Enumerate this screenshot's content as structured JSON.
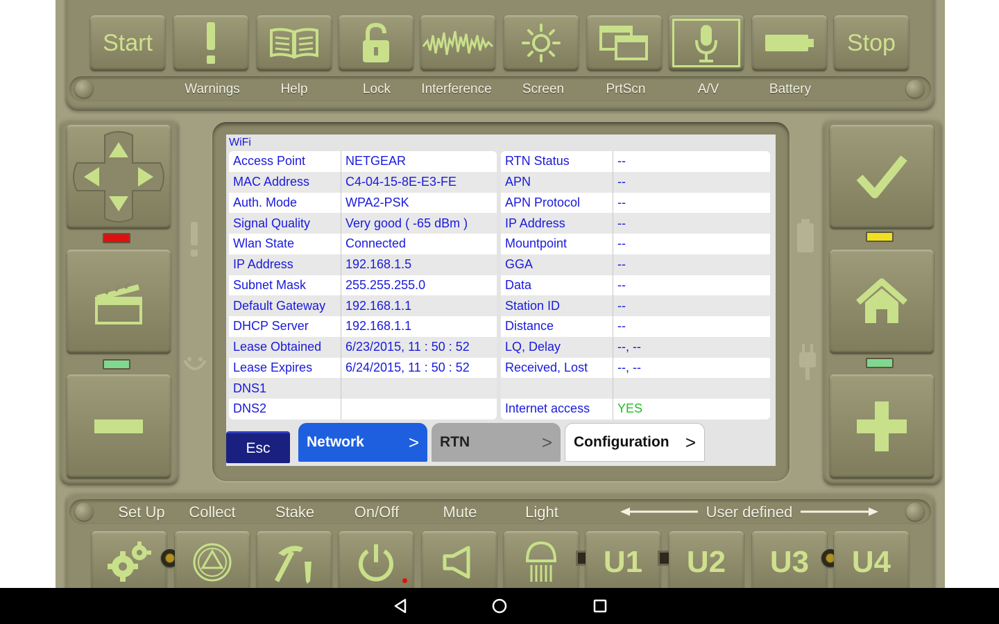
{
  "toolbar": {
    "start_label": "Start",
    "stop_label": "Stop",
    "labels": {
      "warnings": "Warnings",
      "help": "Help",
      "lock": "Lock",
      "interference": "Interference",
      "screen": "Screen",
      "prtscn": "PrtScn",
      "av": "A/V",
      "battery": "Battery"
    }
  },
  "screen": {
    "section_title": "WiFi",
    "wifi_rows": [
      {
        "label": "Access Point",
        "value": "NETGEAR"
      },
      {
        "label": "MAC Address",
        "value": "C4-04-15-8E-E3-FE"
      },
      {
        "label": "Auth. Mode",
        "value": "WPA2-PSK"
      },
      {
        "label": "Signal Quality",
        "value": "Very good ( -65 dBm )"
      },
      {
        "label": "Wlan State",
        "value": "Connected"
      },
      {
        "label": "IP Address",
        "value": "192.168.1.5"
      },
      {
        "label": "Subnet Mask",
        "value": "255.255.255.0"
      },
      {
        "label": "Default Gateway",
        "value": "192.168.1.1"
      },
      {
        "label": "DHCP Server",
        "value": "192.168.1.1"
      },
      {
        "label": "Lease Obtained",
        "value": "6/23/2015, 11 : 50 : 52"
      },
      {
        "label": "Lease Expires",
        "value": "6/24/2015, 11 : 50 : 52"
      },
      {
        "label": "DNS1",
        "value": ""
      },
      {
        "label": "DNS2",
        "value": ""
      }
    ],
    "rtn_rows": [
      {
        "label": "RTN Status",
        "value": "--"
      },
      {
        "label": "APN",
        "value": "--"
      },
      {
        "label": "APN Protocol",
        "value": "--"
      },
      {
        "label": "IP Address",
        "value": "--"
      },
      {
        "label": "Mountpoint",
        "value": "--"
      },
      {
        "label": "GGA",
        "value": "--"
      },
      {
        "label": "Data",
        "value": "--"
      },
      {
        "label": "Station ID",
        "value": "--"
      },
      {
        "label": "Distance",
        "value": "--"
      },
      {
        "label": "LQ, Delay",
        "value": "--, --"
      },
      {
        "label": "Received, Lost",
        "value": "--, --"
      },
      {
        "label": "",
        "value": ""
      },
      {
        "label": "Internet access",
        "value": "YES"
      }
    ],
    "tabs": {
      "esc": "Esc",
      "network": "Network",
      "rtn": "RTN",
      "configuration": "Configuration",
      "chevron": ">"
    }
  },
  "bottom": {
    "labels": {
      "setup": "Set Up",
      "collect": "Collect",
      "stake": "Stake",
      "onoff": "On/Off",
      "mute": "Mute",
      "light": "Light",
      "user_defined": "User defined"
    },
    "u1": "U1",
    "u2": "U2",
    "u3": "U3",
    "u4": "U4"
  },
  "colors": {
    "body": "#a2a080",
    "icon": "#c8e08a",
    "led_red": "#e01010",
    "led_yellow": "#f0e020",
    "led_green": "#80d890",
    "tab_network": "#1e5fe0",
    "tab_esc": "#1a2080",
    "table_text": "#1a1adc",
    "yes_text": "#20c020"
  },
  "icons": {
    "dpad": "dpad-arrows-icon",
    "clapper": "clapperboard-icon",
    "minus": "minus-icon",
    "check": "checkmark-icon",
    "home": "home-icon",
    "plus": "plus-icon"
  }
}
